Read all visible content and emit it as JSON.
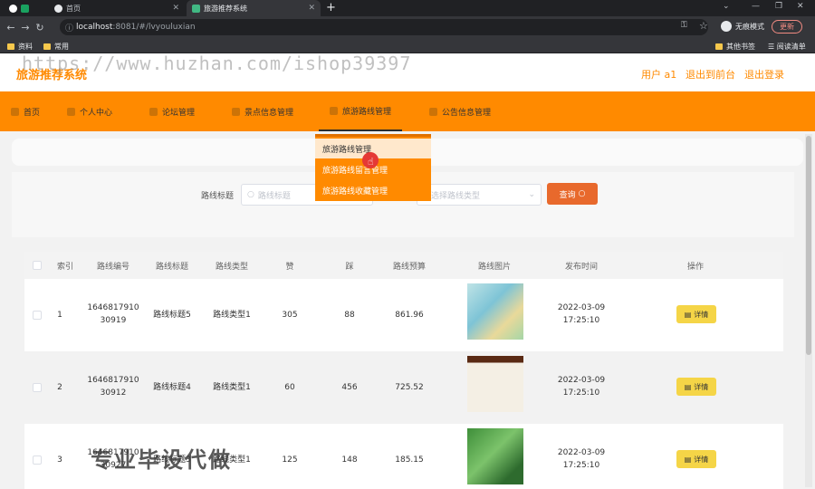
{
  "browser": {
    "tabs": [
      {
        "label": "首页",
        "active": false
      },
      {
        "label": "旅游推荐系统",
        "active": true
      }
    ],
    "new_tab": "+",
    "url_host": "localhost",
    "url_path": ":8081/#/lvyouluxian",
    "incognito_label": "无痕模式",
    "update_label": "更新",
    "bookmarks": [
      "资料",
      "常用"
    ],
    "bookmarks_right": [
      "其他书签",
      "阅读清单"
    ]
  },
  "site": {
    "title": "旅游推荐系统",
    "watermark": "https://www.huzhan.com/ishop39397",
    "user_label": "用户 a1",
    "back_link": "退出到前台",
    "logout_link": "退出登录",
    "bottom_watermark": "专业毕设代做"
  },
  "nav": [
    {
      "label": "首页",
      "icon": "home-icon"
    },
    {
      "label": "个人中心",
      "icon": "user-icon"
    },
    {
      "label": "论坛管理",
      "icon": "forum-icon"
    },
    {
      "label": "景点信息管理",
      "icon": "scenic-icon"
    },
    {
      "label": "旅游路线管理",
      "icon": "route-icon",
      "active": true
    },
    {
      "label": "公告信息管理",
      "icon": "notice-icon"
    }
  ],
  "dropdown": [
    "旅游路线管理",
    "旅游路线留言管理",
    "旅游路线收藏管理"
  ],
  "search": {
    "label": "路线标题",
    "title_placeholder": "路线标题",
    "type_placeholder": "请选择路线类型",
    "query_label": "查询"
  },
  "table": {
    "headers": [
      "索引",
      "路线编号",
      "路线标题",
      "路线类型",
      "赞",
      "踩",
      "路线预算",
      "路线图片",
      "发布时间",
      "操作"
    ],
    "detail_label": "详情",
    "rows": [
      {
        "index": "1",
        "code1": "1646817910",
        "code2": "30919",
        "title": "路线标题5",
        "type": "路线类型1",
        "like": "305",
        "dislike": "88",
        "budget": "861.96",
        "date": "2022-03-09",
        "time": "17:25:10"
      },
      {
        "index": "2",
        "code1": "1646817910",
        "code2": "30912",
        "title": "路线标题4",
        "type": "路线类型1",
        "like": "60",
        "dislike": "456",
        "budget": "725.52",
        "date": "2022-03-09",
        "time": "17:25:10"
      },
      {
        "index": "3",
        "code1": "1646817910",
        "code2": "30927",
        "title": "路线标题3",
        "type": "路线类型1",
        "like": "125",
        "dislike": "148",
        "budget": "185.15",
        "date": "2022-03-09",
        "time": "17:25:10"
      }
    ]
  },
  "colors": {
    "accent": "#ff8a00",
    "query_button": "#e8692c",
    "detail_button": "#f5d547"
  }
}
